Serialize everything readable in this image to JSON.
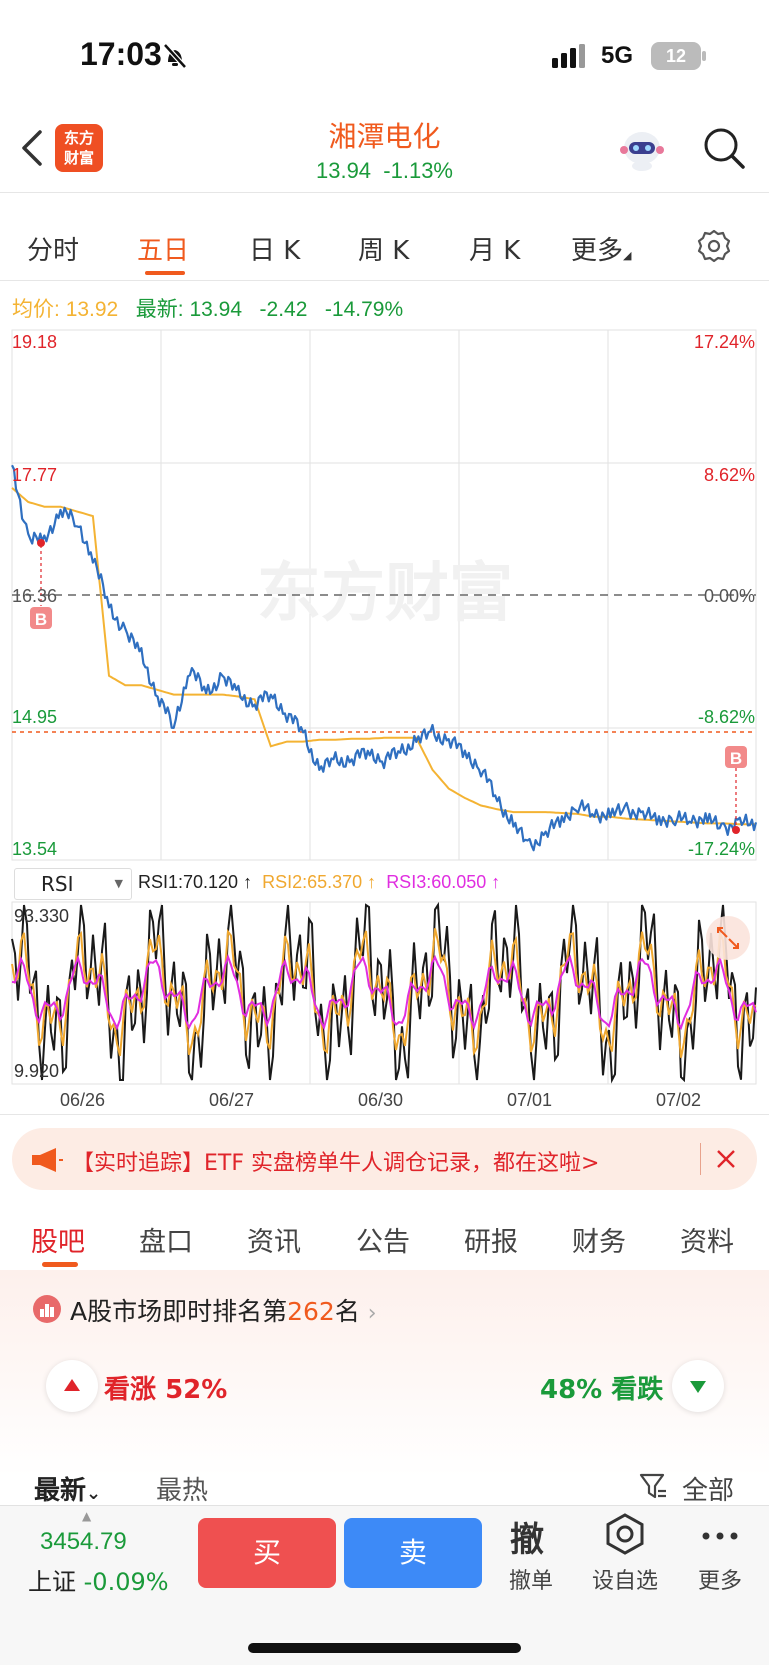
{
  "status": {
    "time": "17:03",
    "network": "5G",
    "battery": "12"
  },
  "header": {
    "logo_line1": "东方",
    "logo_line2": "财富",
    "stock_name": "湘潭电化",
    "price": "13.94",
    "change_pct": "-1.13%"
  },
  "chart_tabs": [
    {
      "label": "分时"
    },
    {
      "label": "五日"
    },
    {
      "label": "日 K"
    },
    {
      "label": "周 K"
    },
    {
      "label": "月 K"
    },
    {
      "label": "更多"
    }
  ],
  "info": {
    "avg_label": "均价:",
    "avg_value": "13.92",
    "latest_label": "最新:",
    "latest_value": "13.94",
    "change": "-2.42",
    "change_pct": "-14.79%"
  },
  "price_axis": {
    "p1": "19.18",
    "p2": "17.77",
    "p3": "16.36",
    "p4": "14.95",
    "p5": "13.54",
    "r1": "17.24%",
    "r2": "8.62%",
    "r3": "0.00%",
    "r4": "-8.62%",
    "r5": "-17.24%"
  },
  "watermark": "东方财富",
  "marker_label": "B",
  "rsi": {
    "select": "RSI",
    "rsi1": "RSI1:70.120 ↑",
    "rsi2": "RSI2:65.370 ↑",
    "rsi3": "RSI3:60.050 ↑",
    "max": "93.330",
    "min": "9.920"
  },
  "dates": [
    "06/26",
    "06/27",
    "06/30",
    "07/01",
    "07/02"
  ],
  "banner": {
    "text": "【实时追踪】ETF 实盘榜单牛人调仓记录，都在这啦>"
  },
  "bottom_tabs": [
    {
      "label": "股吧"
    },
    {
      "label": "盘口"
    },
    {
      "label": "资讯"
    },
    {
      "label": "公告"
    },
    {
      "label": "研报"
    },
    {
      "label": "财务"
    },
    {
      "label": "资料"
    }
  ],
  "rank": {
    "prefix": "A股市场即时排名第",
    "number": "262",
    "suffix": "名"
  },
  "sentiment": {
    "bull_label": "看涨",
    "bull_pct": "52%",
    "bear_pct": "48%",
    "bear_label": "看跌"
  },
  "sort": {
    "latest": "最新",
    "hot": "最热",
    "filter": "全部"
  },
  "bottom_bar": {
    "index_value": "3454.79",
    "index_name": "上证",
    "index_change": "-0.09%",
    "buy": "买",
    "sell": "卖",
    "cancel_icon_text": "撤",
    "cancel": "撤单",
    "watchlist": "设自选",
    "more": "更多"
  },
  "colors": {
    "accent": "#f05a1e",
    "up": "#e0242a",
    "down": "#1a9a3a",
    "price_line": "#2f6fc0",
    "avg_line": "#f4b333",
    "rsi1": "#1a1a1a",
    "rsi2": "#f0a830",
    "rsi3": "#e02ee0"
  },
  "chart_data": {
    "type": "line",
    "title": "",
    "xlabel": "",
    "ylabel": "",
    "categories": [
      "06/26",
      "06/27",
      "06/30",
      "07/01",
      "07/02"
    ],
    "ylim": [
      13.54,
      19.18
    ],
    "reference_close": 16.36,
    "series": [
      {
        "values": [
          17.7,
          17.0,
          16.9,
          17.3,
          17.1,
          16.8,
          16.2,
          16.0,
          15.7,
          15.3,
          14.95,
          15.6,
          15.3,
          15.5,
          15.3,
          15.2,
          15.3,
          15.1,
          14.9,
          14.5,
          14.6,
          14.6,
          14.7,
          14.6,
          14.7,
          14.8,
          14.9,
          14.8,
          14.7,
          14.5,
          14.2,
          13.9,
          13.7,
          13.8,
          14.0,
          14.1,
          14.05,
          14.0,
          14.1,
          14.0,
          14.0,
          13.95,
          14.0,
          13.95,
          13.9,
          13.92,
          13.94
        ]
      },
      {
        "values": [
          17.5,
          17.35,
          17.3,
          17.3,
          17.25,
          17.2,
          15.5,
          15.4,
          15.4,
          15.35,
          15.3,
          15.3,
          15.3,
          15.3,
          15.28,
          15.25,
          14.75,
          14.8,
          14.8,
          14.82,
          14.82,
          14.83,
          14.83,
          14.84,
          14.84,
          14.84,
          14.5,
          14.3,
          14.2,
          14.12,
          14.08,
          14.05,
          14.05,
          14.05,
          14.04,
          14.03,
          14.0,
          14.0,
          13.98,
          13.97,
          13.96,
          13.95,
          13.94,
          13.93,
          13.93,
          13.92,
          13.92
        ]
      }
    ]
  }
}
